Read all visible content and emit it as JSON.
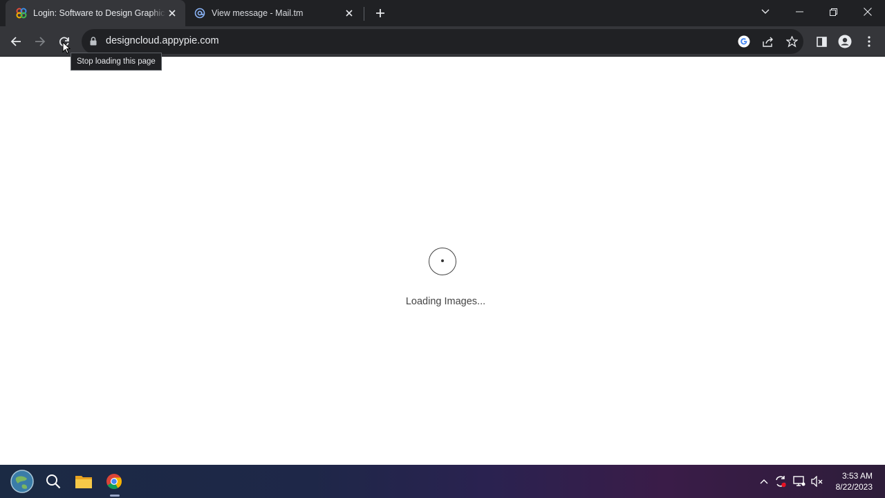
{
  "browser": {
    "tabs": [
      {
        "title": "Login: Software to Design Graphics",
        "favicon": "appypie-logo-icon",
        "active": true
      },
      {
        "title": "View message - Mail.tm",
        "favicon": "at-sign-icon",
        "active": false
      }
    ],
    "address_bar": {
      "url": "designcloud.appypie.com",
      "security": "lock-icon"
    },
    "reload_tooltip": "Stop loading this page"
  },
  "page": {
    "loading_text": "Loading Images..."
  },
  "taskbar": {
    "apps": [
      "start-globe-icon",
      "search-icon",
      "file-explorer-icon",
      "chrome-icon"
    ],
    "clock": {
      "time": "3:53 AM",
      "date": "8/22/2023"
    }
  },
  "colors": {
    "tabstrip": "#202124",
    "toolbar": "#35363a",
    "omnibox": "#202124",
    "text_light": "#e8eaed"
  }
}
